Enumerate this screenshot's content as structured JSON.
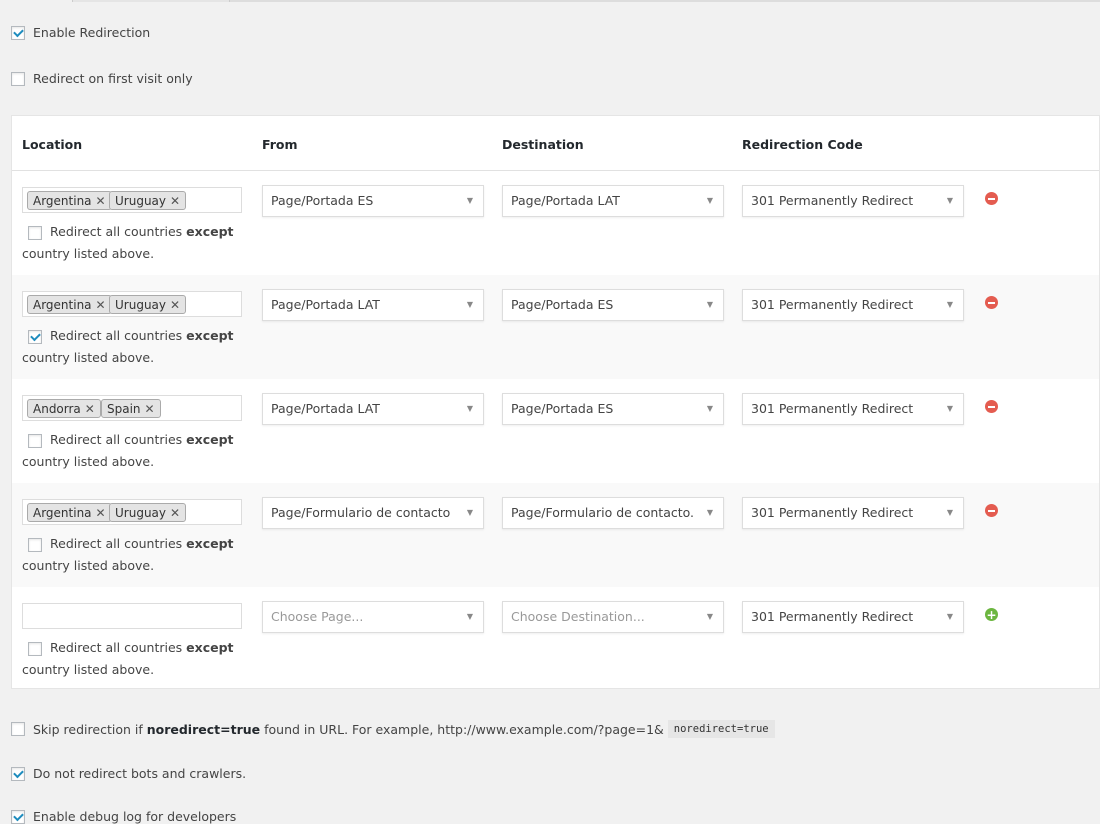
{
  "options": {
    "enable_redirection": {
      "label": "Enable Redirection",
      "checked": true
    },
    "first_visit_only": {
      "label": "Redirect on first visit only",
      "checked": false
    }
  },
  "table": {
    "headers": {
      "location": "Location",
      "from": "From",
      "destination": "Destination",
      "code": "Redirection Code"
    },
    "except_prefix": "Redirect all countries",
    "except_bold": "except",
    "except_suffix": "country listed above.",
    "remove_icon": "minus-circle-icon",
    "add_icon": "plus-circle-icon",
    "rows": [
      {
        "tags": [
          "Argentina",
          "Uruguay"
        ],
        "except": false,
        "from": "Page/Portada ES",
        "destination": "Page/Portada LAT",
        "code": "301 Permanently Redirect"
      },
      {
        "tags": [
          "Argentina",
          "Uruguay"
        ],
        "except": true,
        "from": "Page/Portada LAT",
        "destination": "Page/Portada ES",
        "code": "301 Permanently Redirect"
      },
      {
        "tags": [
          "Andorra",
          "Spain"
        ],
        "except": false,
        "from": "Page/Portada LAT",
        "destination": "Page/Portada ES",
        "code": "301 Permanently Redirect"
      },
      {
        "tags": [
          "Argentina",
          "Uruguay"
        ],
        "except": false,
        "from": "Page/Formulario de contacto",
        "destination": "Page/Formulario de contacto.",
        "code": "301 Permanently Redirect"
      }
    ],
    "new_row": {
      "from_placeholder": "Choose Page...",
      "destination_placeholder": "Choose Destination...",
      "code": "301 Permanently Redirect"
    }
  },
  "skip": {
    "prefix": "Skip redirection if",
    "bold": "noredirect=true",
    "suffix": "found in URL. For example, http://www.example.com/?page=1&",
    "code": "noredirect=true",
    "checked": false
  },
  "bots": {
    "label": "Do not redirect bots and crawlers.",
    "checked": true
  },
  "debug": {
    "label": "Enable debug log for developers",
    "checked": true
  }
}
